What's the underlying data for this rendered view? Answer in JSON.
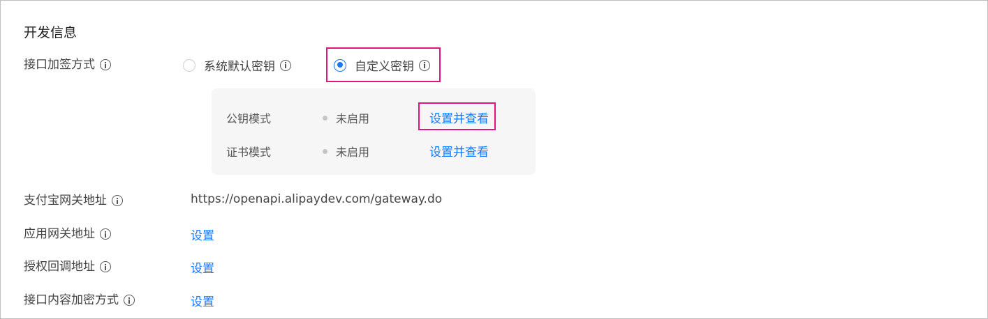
{
  "section": {
    "title": "开发信息"
  },
  "sign_method": {
    "label": "接口加签方式",
    "options": [
      {
        "label": "系统默认密钥",
        "selected": false
      },
      {
        "label": "自定义密钥",
        "selected": true
      }
    ]
  },
  "key_modes": [
    {
      "label": "公钥模式",
      "status": "未启用",
      "action": "设置并查看"
    },
    {
      "label": "证书模式",
      "status": "未启用",
      "action": "设置并查看"
    }
  ],
  "alipay_gateway": {
    "label": "支付宝网关地址",
    "value": "https://openapi.alipaydev.com/gateway.do"
  },
  "app_gateway": {
    "label": "应用网关地址",
    "action": "设置"
  },
  "auth_callback": {
    "label": "授权回调地址",
    "action": "设置"
  },
  "encrypt_method": {
    "label": "接口内容加密方式",
    "action": "设置"
  },
  "colors": {
    "link": "#1677ff",
    "highlight": "#e0157f",
    "panel_bg": "#f6f6f6"
  }
}
